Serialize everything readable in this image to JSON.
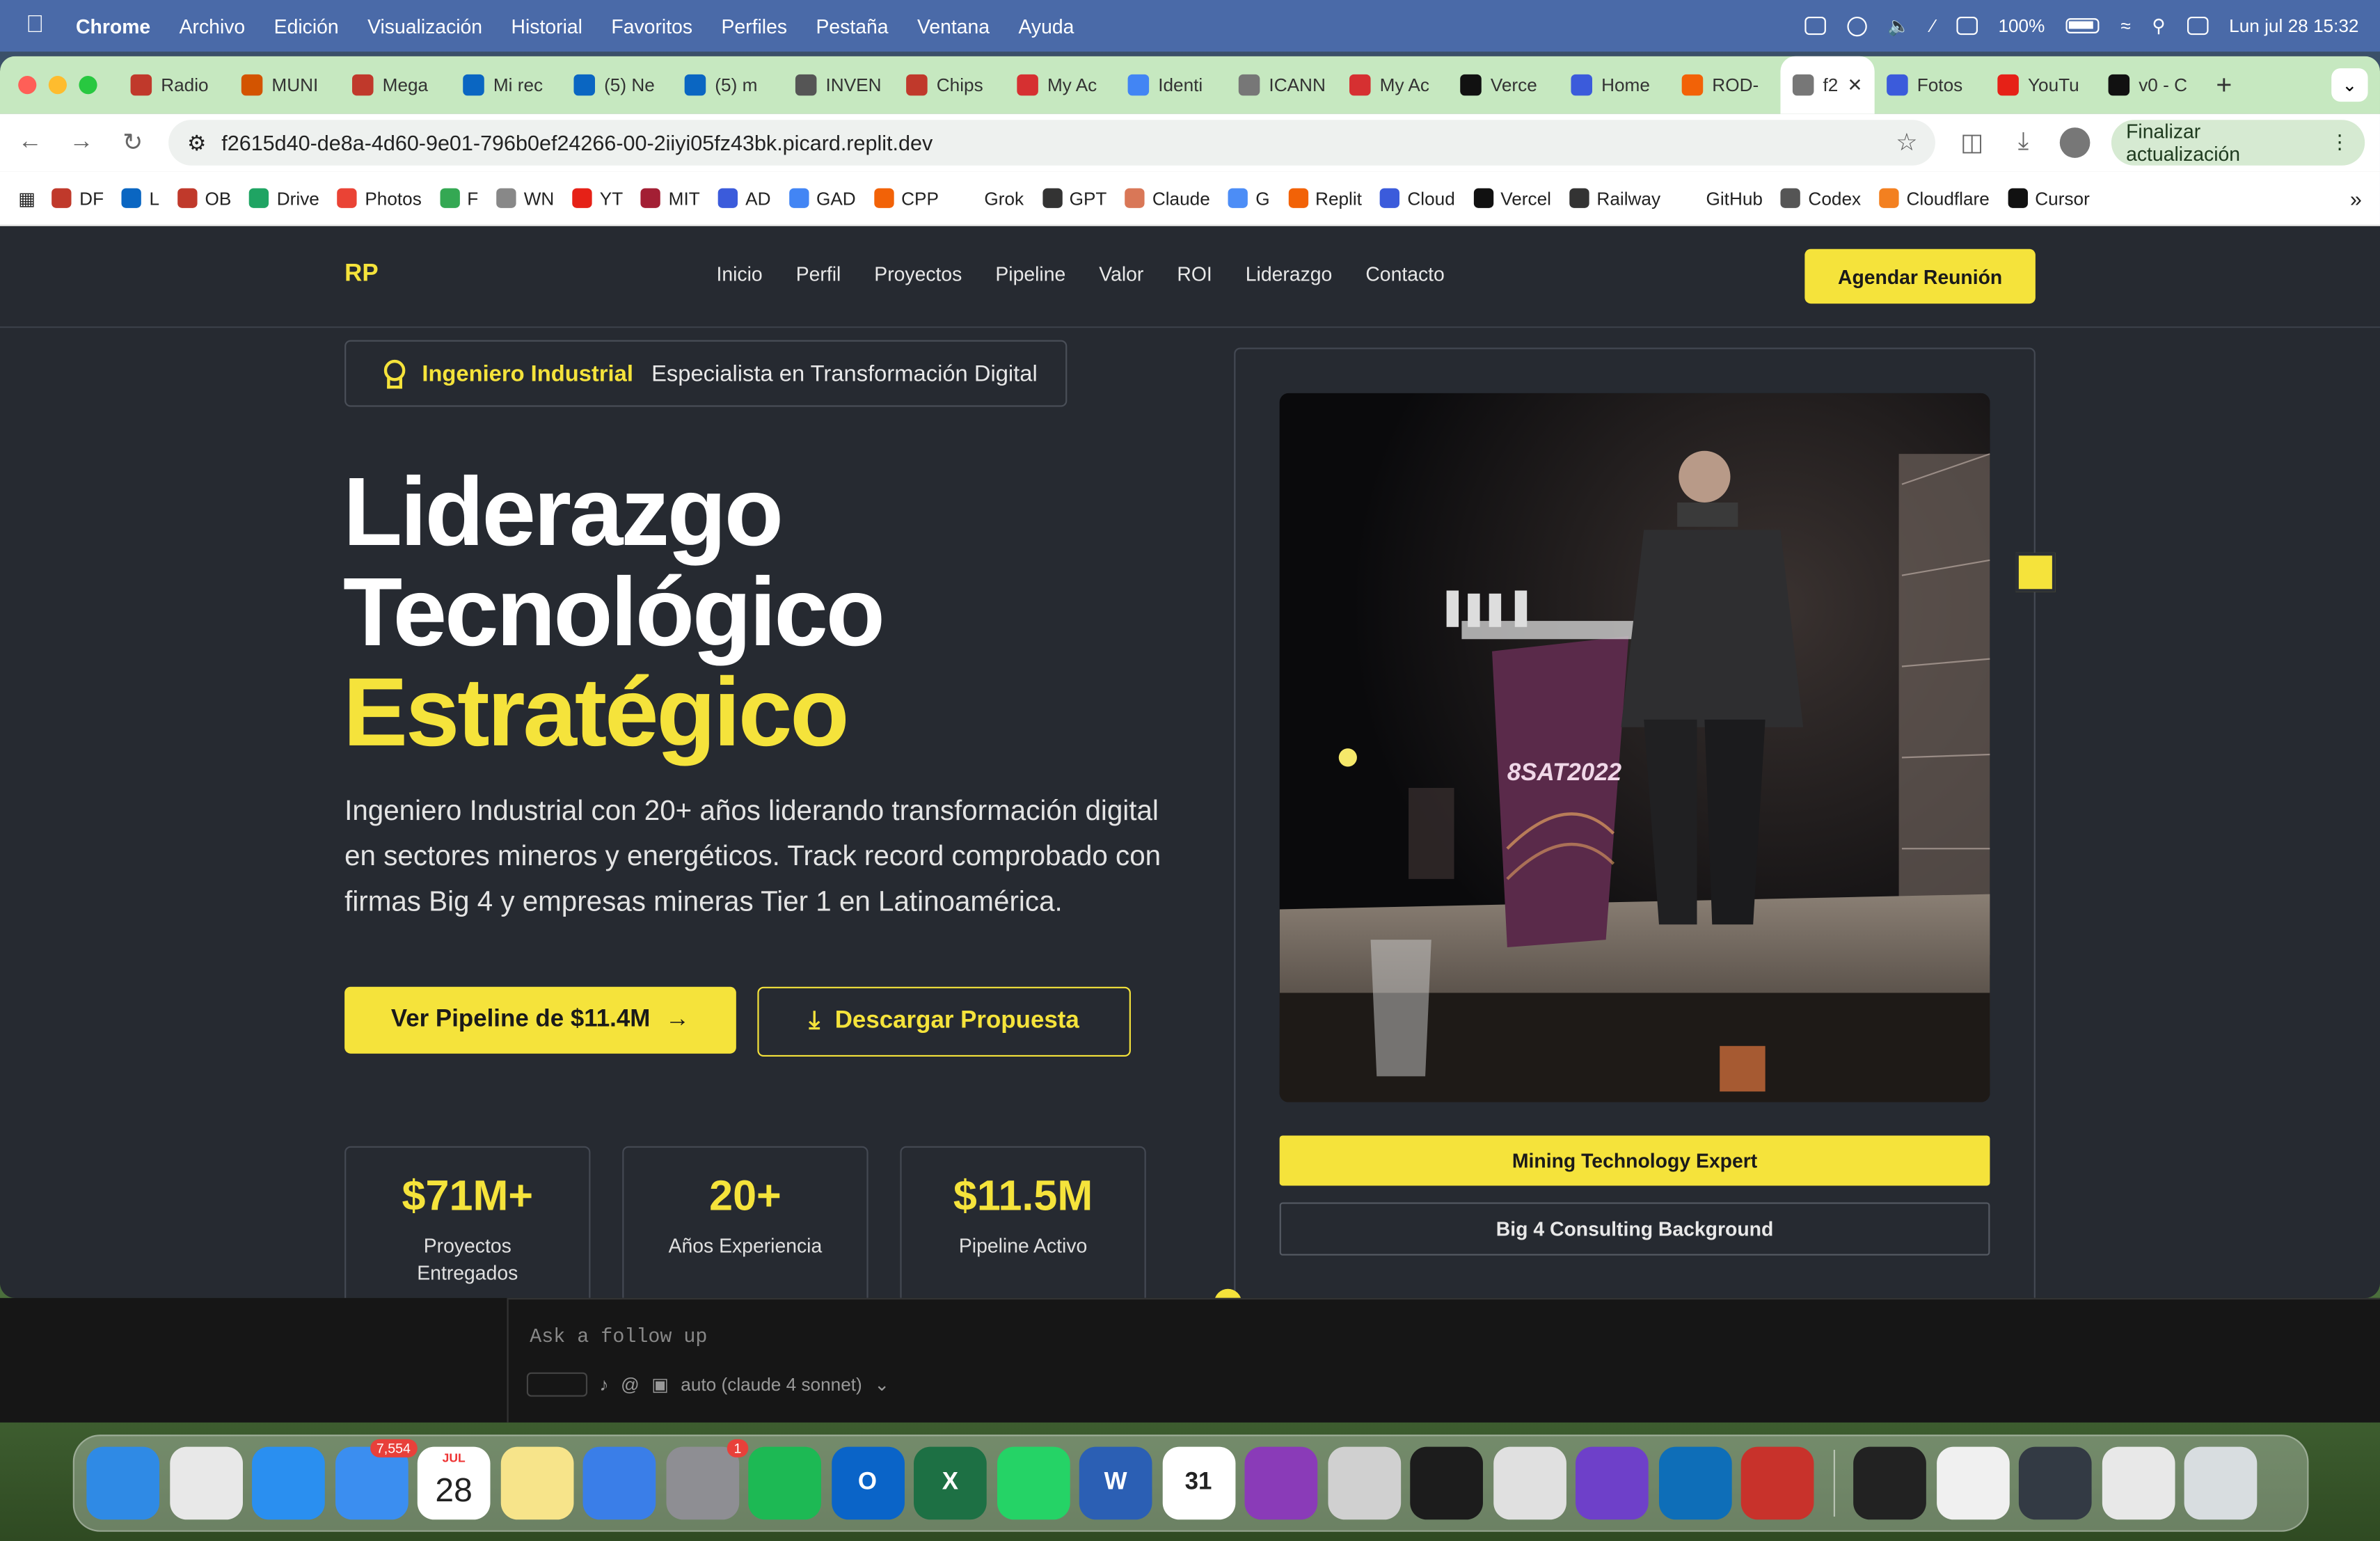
{
  "menubar": {
    "app": "Chrome",
    "items": [
      "Archivo",
      "Edición",
      "Visualización",
      "Historial",
      "Favoritos",
      "Perfiles",
      "Pestaña",
      "Ventana",
      "Ayuda"
    ],
    "battery": "100%",
    "datetime": "Lun jul 28  15:32"
  },
  "tabs": [
    {
      "label": "Radio",
      "color": "#c0392b"
    },
    {
      "label": "MUNI",
      "color": "#d35400"
    },
    {
      "label": "Mega",
      "color": "#c0392b"
    },
    {
      "label": "Mi rec",
      "color": "#0a66c2"
    },
    {
      "label": "(5) Ne",
      "color": "#0a66c2"
    },
    {
      "label": "(5) m",
      "color": "#0a66c2"
    },
    {
      "label": "INVEN",
      "color": "#555555"
    },
    {
      "label": "Chips",
      "color": "#c0392b"
    },
    {
      "label": "My Ac",
      "color": "#d63031"
    },
    {
      "label": "Identi",
      "color": "#4285f4"
    },
    {
      "label": "ICANN",
      "color": "#777777"
    },
    {
      "label": "My Ac",
      "color": "#d63031"
    },
    {
      "label": "Verce",
      "color": "#111111"
    },
    {
      "label": "Home",
      "color": "#3b5bdb"
    },
    {
      "label": "ROD-",
      "color": "#f26207"
    },
    {
      "label": "f2",
      "color": "#777777"
    },
    {
      "label": "Fotos",
      "color": "#3b5bdb"
    },
    {
      "label": "YouTu",
      "color": "#e62117"
    },
    {
      "label": "v0 - C",
      "color": "#111111"
    }
  ],
  "address": {
    "url": "f2615d40-de8a-4d60-9e01-796b0ef24266-00-2iiyi05fz43bk.picard.replit.dev",
    "update_label": "Finalizar actualización"
  },
  "bookmarks": [
    {
      "label": "DF",
      "color": "#c0392b"
    },
    {
      "label": "L",
      "color": "#0a66c2"
    },
    {
      "label": "OB",
      "color": "#c0392b"
    },
    {
      "label": "Drive",
      "color": "#1fa463"
    },
    {
      "label": "Photos",
      "color": "#ea4335"
    },
    {
      "label": "F",
      "color": "#34a853"
    },
    {
      "label": "WN",
      "color": "#888888"
    },
    {
      "label": "YT",
      "color": "#e62117"
    },
    {
      "label": "MIT",
      "color": "#a31f34"
    },
    {
      "label": "AD",
      "color": "#3b5bdb"
    },
    {
      "label": "GAD",
      "color": "#4285f4"
    },
    {
      "label": "CPP",
      "color": "#f26207"
    },
    {
      "label": "Grok",
      "color": "#ffffff"
    },
    {
      "label": "GPT",
      "color": "#333333"
    },
    {
      "label": "Claude",
      "color": "#d97757"
    },
    {
      "label": "G",
      "color": "#4c8df6"
    },
    {
      "label": "Replit",
      "color": "#f26207"
    },
    {
      "label": "Cloud",
      "color": "#3b5bdb"
    },
    {
      "label": "Vercel",
      "color": "#111111"
    },
    {
      "label": "Railway",
      "color": "#333333"
    },
    {
      "label": "GitHub",
      "color": "#ffffff"
    },
    {
      "label": "Codex",
      "color": "#555555"
    },
    {
      "label": "Cloudflare",
      "color": "#f38020"
    },
    {
      "label": "Cursor",
      "color": "#111111"
    }
  ],
  "site": {
    "logo": "RP",
    "nav": [
      "Inicio",
      "Perfil",
      "Proyectos",
      "Pipeline",
      "Valor",
      "ROI",
      "Liderazgo",
      "Contacto"
    ],
    "cta": "Agendar Reunión",
    "badge_highlight": "Ingeniero Industrial",
    "badge_text": "Especialista en Transformación Digital",
    "headline_line1": "Liderazgo",
    "headline_line2": "Tecnológico",
    "headline_line3": "Estratégico",
    "lead": "Ingeniero Industrial con 20+ años liderando transformación digital en sectores mineros y energéticos. Track record comprobado con firmas Big 4 y empresas mineras Tier 1 en Latinoamérica.",
    "btn_primary": "Ver Pipeline de $11.4M",
    "btn_secondary": "Descargar Propuesta",
    "stats": [
      {
        "value": "$71M+",
        "label": "Proyectos Entregados"
      },
      {
        "value": "20+",
        "label": "Años Experiencia"
      },
      {
        "value": "$11.5M",
        "label": "Pipeline Activo"
      }
    ],
    "photo_podium_text": "8SAT2022",
    "tag1": "Mining Technology Expert",
    "tag2": "Big 4 Consulting Background",
    "accent": "#f5e33b"
  },
  "terminal": {
    "placeholder": "Ask a follow up",
    "model": "auto (claude 4 sonnet)"
  },
  "dock": {
    "apps": [
      {
        "name": "finder",
        "color": "#2f8ae5",
        "text": ""
      },
      {
        "name": "chrome",
        "color": "#e8e8e8",
        "text": ""
      },
      {
        "name": "safari",
        "color": "#2a8ff0",
        "text": ""
      },
      {
        "name": "mail",
        "color": "#3b8ef0",
        "text": "",
        "badge": "7,554"
      },
      {
        "name": "calendar",
        "color": "#ffffff",
        "text": "28",
        "sub": "JUL"
      },
      {
        "name": "notes",
        "color": "#f7e48a",
        "text": ""
      },
      {
        "name": "keynote",
        "color": "#3a7ee8",
        "text": ""
      },
      {
        "name": "system-settings",
        "color": "#8e8e93",
        "text": "",
        "badge": "1"
      },
      {
        "name": "spotify",
        "color": "#1db954",
        "text": ""
      },
      {
        "name": "outlook",
        "color": "#0a64c8",
        "text": "O"
      },
      {
        "name": "excel",
        "color": "#1d7044",
        "text": "X"
      },
      {
        "name": "whatsapp",
        "color": "#25d366",
        "text": ""
      },
      {
        "name": "word",
        "color": "#2b5fb4",
        "text": "W"
      },
      {
        "name": "calendar-31",
        "color": "#ffffff",
        "text": "31"
      },
      {
        "name": "circle-app",
        "color": "#8a3bb8",
        "text": ""
      },
      {
        "name": "iphone-mirroring",
        "color": "#d0d0d0",
        "text": ""
      },
      {
        "name": "replit",
        "color": "#1c1c1c",
        "text": ""
      },
      {
        "name": "parallels",
        "color": "#e0e0e0",
        "text": ""
      },
      {
        "name": "github-desktop",
        "color": "#6e40c9",
        "text": ""
      },
      {
        "name": "vscode",
        "color": "#0e6eb8",
        "text": ""
      },
      {
        "name": "photo-booth",
        "color": "#c8322b",
        "text": ""
      },
      {
        "name": "cube-app",
        "color": "#222222",
        "text": ""
      },
      {
        "name": "zip-file",
        "color": "#f0f0f0",
        "text": ""
      },
      {
        "name": "screenshot-1",
        "color": "#333a44",
        "text": ""
      },
      {
        "name": "screenshot-2",
        "color": "#e8e8e8",
        "text": ""
      },
      {
        "name": "trash",
        "color": "#d8dde0",
        "text": ""
      }
    ]
  }
}
